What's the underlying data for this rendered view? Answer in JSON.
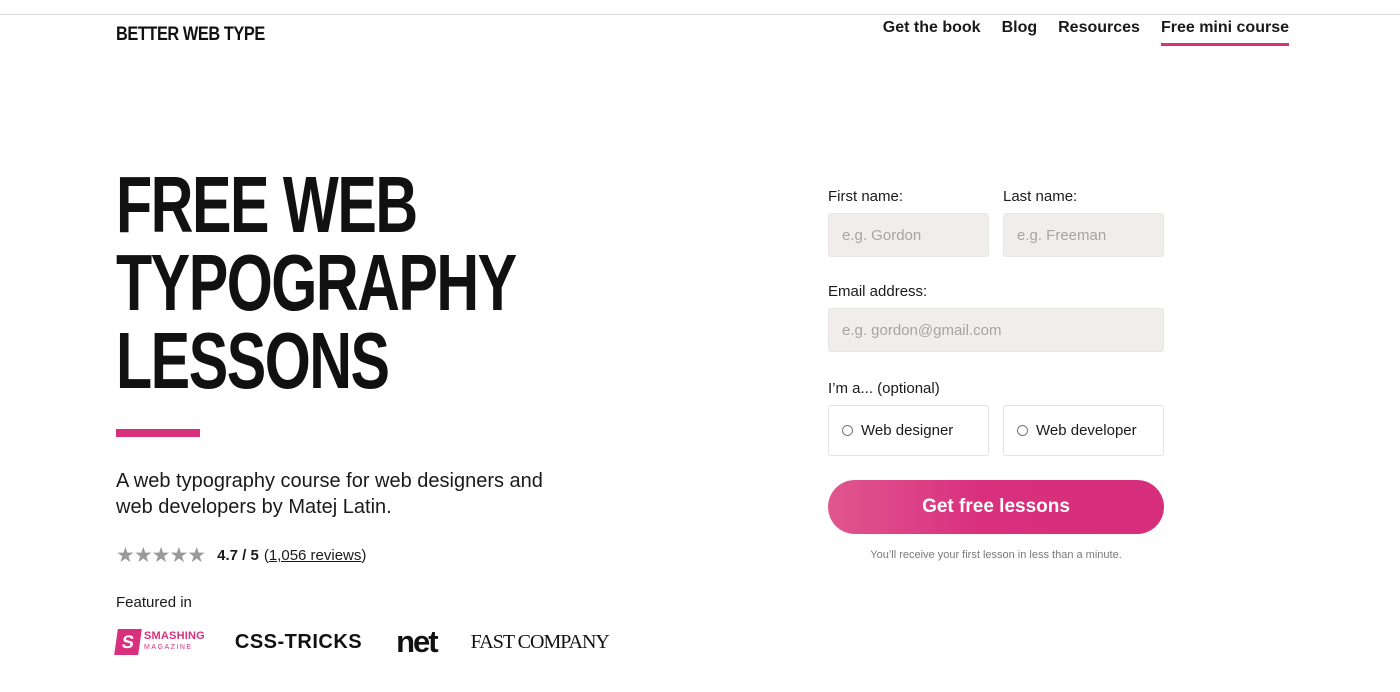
{
  "header": {
    "logo": "BETTER WEB TYPE",
    "nav": [
      {
        "label": "Get the book"
      },
      {
        "label": "Blog"
      },
      {
        "label": "Resources"
      },
      {
        "label": "Free mini course"
      }
    ],
    "active_nav": "Free mini course"
  },
  "hero": {
    "title_lines": [
      "FREE WEB",
      "TYPOGRAPHY",
      "LESSONS"
    ],
    "subtitle": "A web typography course for web designers and web developers by Matej Latin.",
    "rating": {
      "stars": "★★★★★",
      "score": "4.7 / 5",
      "reviews_open": "(",
      "reviews_link": "1,056 reviews",
      "reviews_close": ")"
    },
    "featured_label": "Featured in",
    "featured_logos": {
      "smashing_mark": "S",
      "smashing_name": "SMASHING",
      "smashing_sub": "MAGAZINE",
      "css_tricks": "CSS-TRICKS",
      "net": "net",
      "fast_company": "FAST COMPANY"
    }
  },
  "form": {
    "first_name_label": "First name:",
    "first_name_placeholder": "e.g. Gordon",
    "last_name_label": "Last name:",
    "last_name_placeholder": "e.g. Freeman",
    "email_label": "Email address:",
    "email_placeholder": "e.g. gordon@gmail.com",
    "role_label": "I’m a... (optional)",
    "role_options": [
      "Web designer",
      "Web developer"
    ],
    "submit_label": "Get free lessons",
    "note": "You’ll receive your first lesson in less than a minute."
  },
  "colors": {
    "accent": "#d9307e",
    "input_bg": "#f0eded"
  }
}
